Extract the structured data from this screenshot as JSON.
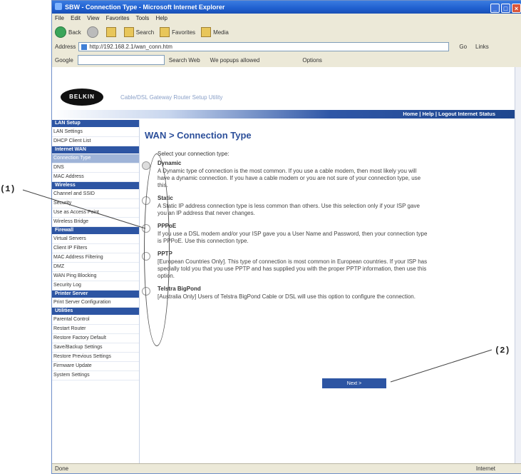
{
  "window": {
    "title": "SBW - Connection Type - Microsoft Internet Explorer",
    "controls": {
      "minimize": "_",
      "maximize": "□",
      "close": "×"
    }
  },
  "menubar": [
    "File",
    "Edit",
    "View",
    "Favorites",
    "Tools",
    "Help"
  ],
  "toolbar": {
    "back": "Back",
    "search": "Search",
    "favorites": "Favorites",
    "media": "Media"
  },
  "address": {
    "label": "Address",
    "url": "http://192.168.2.1/wan_conn.htm",
    "go": "Go",
    "links": "Links"
  },
  "googlebar": {
    "label": "Google",
    "search_web": "Search Web",
    "blocked": "We popups allowed",
    "options": "Options"
  },
  "header": {
    "logo": "BELKIN",
    "product": "Cable/DSL Gateway Router Setup Utility",
    "links": "Home | Help | Logout   Internet Status"
  },
  "sidebar": {
    "sections": [
      {
        "title": "LAN Setup",
        "items": [
          "LAN Settings",
          "DHCP Client List"
        ]
      },
      {
        "title": "Internet WAN",
        "items": [
          "Connection Type",
          "DNS",
          "MAC Address"
        ]
      },
      {
        "title": "Wireless",
        "items": [
          "Channel and SSID",
          "Security",
          "Use as Access Point",
          "Wireless Bridge"
        ]
      },
      {
        "title": "Firewall",
        "items": [
          "Virtual Servers",
          "Client IP Filters",
          "MAC Address Filtering",
          "DMZ",
          "WAN Ping Blocking",
          "Security Log"
        ]
      },
      {
        "title": "Printer Server",
        "items": [
          "Print Server Configuration"
        ]
      },
      {
        "title": "Utilities",
        "items": [
          "Parental Control",
          "Restart Router",
          "Restore Factory Default",
          "Save/Backup Settings",
          "Restore Previous Settings",
          "Firmware Update",
          "System Settings"
        ]
      }
    ]
  },
  "main": {
    "title": "WAN > Connection Type",
    "prompt": "Select your connection type:",
    "options": [
      {
        "name": "Dynamic",
        "desc": "A Dynamic type of connection is the most common. If you use a cable modem, then most likely you will have a dynamic connection. If you have a cable modem or you are not sure of your connection type, use this."
      },
      {
        "name": "Static",
        "desc": "A Static IP address connection type is less common than others. Use this selection only if your ISP gave you an IP address that never changes."
      },
      {
        "name": "PPPoE",
        "desc": "If you use a DSL modem and/or your ISP gave you a User Name and Password, then your connection type is PPPoE. Use this connection type."
      },
      {
        "name": "PPTP",
        "desc": "[European Countries Only]. This type of connection is most common in European countries. If your ISP has specially told you that you use PPTP and has supplied you with the proper PPTP information, then use this option."
      },
      {
        "name": "Telstra BigPond",
        "desc": "[Australia Only] Users of Telstra BigPond Cable or DSL will use this option to configure the connection."
      }
    ],
    "next": "Next >"
  },
  "statusbar": {
    "left": "Done",
    "zone": "Internet"
  },
  "callouts": {
    "one": "(1)",
    "two": "(2)"
  }
}
